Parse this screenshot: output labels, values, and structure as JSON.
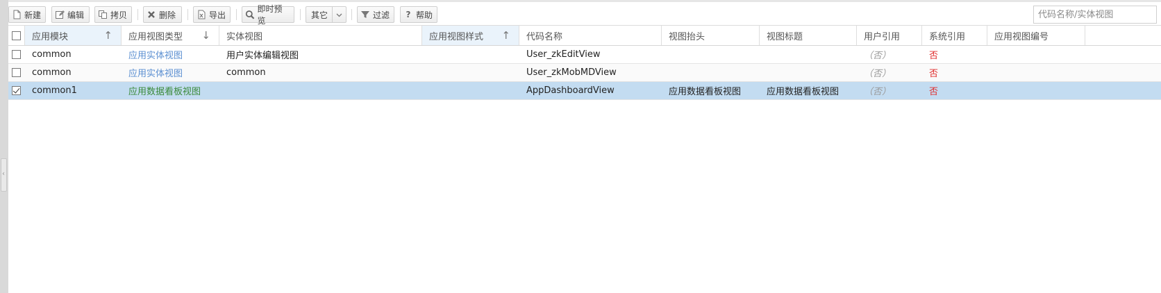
{
  "toolbar": {
    "buttons": [
      {
        "label": "新建",
        "icon": "new-file-icon"
      },
      {
        "label": "编辑",
        "icon": "edit-icon"
      },
      {
        "label": "拷贝",
        "icon": "copy-icon"
      },
      {
        "label": "删除",
        "icon": "delete-icon"
      },
      {
        "label": "导出",
        "icon": "export-excel-icon"
      },
      {
        "label": "即时预览",
        "icon": "magnifier-icon"
      },
      {
        "label": "其它",
        "icon": "chevron-down-icon"
      },
      {
        "label": "过滤",
        "icon": "filter-icon"
      },
      {
        "label": "帮助",
        "icon": "help-icon"
      }
    ],
    "search_placeholder": "代码名称/实体视图"
  },
  "table": {
    "columns": [
      {
        "label": "应用模块",
        "sort": "asc",
        "highlighted": true
      },
      {
        "label": "应用视图类型",
        "sort": "desc",
        "highlighted": false
      },
      {
        "label": "实体视图"
      },
      {
        "label": "应用视图样式",
        "sort": "asc",
        "highlighted": true
      },
      {
        "label": "代码名称"
      },
      {
        "label": "视图抬头"
      },
      {
        "label": "视图标题"
      },
      {
        "label": "用户引用"
      },
      {
        "label": "系统引用"
      },
      {
        "label": "应用视图编号"
      }
    ],
    "rows": [
      {
        "checked": false,
        "module": "common",
        "view_type": "应用实体视图",
        "entity_view": "用户实体编辑视图",
        "view_style": "",
        "code_name": "User_zkEditView",
        "caption": "",
        "title": "",
        "user_ref": "（否）",
        "sys_ref": "否",
        "view_no": ""
      },
      {
        "checked": false,
        "module": "common",
        "view_type": "应用实体视图",
        "entity_view": "common",
        "view_style": "",
        "code_name": "User_zkMobMDView",
        "caption": "",
        "title": "",
        "user_ref": "（否）",
        "sys_ref": "否",
        "view_no": ""
      },
      {
        "checked": true,
        "module": "common1",
        "view_type": "应用数据看板视图",
        "entity_view": "",
        "view_style": "",
        "code_name": "AppDashboardView",
        "caption": "应用数据看板视图",
        "title": "应用数据看板视图",
        "user_ref": "（否）",
        "sys_ref": "否",
        "view_no": ""
      }
    ]
  },
  "colors": {
    "selected_row": "#c3dcf1",
    "link": "#5b8fd1",
    "dashboard_link": "#3a8a3a",
    "sys_ref": "#e03030"
  }
}
